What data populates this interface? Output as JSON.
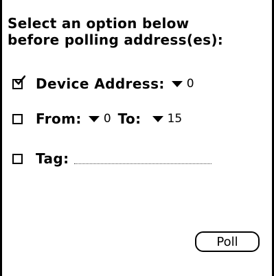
{
  "heading": {
    "line1": "Select an option below",
    "line2": "before polling address(es):"
  },
  "options": {
    "device_address": {
      "checked": true,
      "label": "Device Address:",
      "value": "0"
    },
    "range": {
      "checked": false,
      "from_label": "From:",
      "from_value": "0",
      "to_label": "To:",
      "to_value": "15"
    },
    "tag": {
      "checked": false,
      "label": "Tag:",
      "value": ""
    }
  },
  "buttons": {
    "poll_label": "Poll"
  },
  "icons": {
    "check": "checkmark-icon",
    "dropdown": "triangle-down-icon"
  }
}
